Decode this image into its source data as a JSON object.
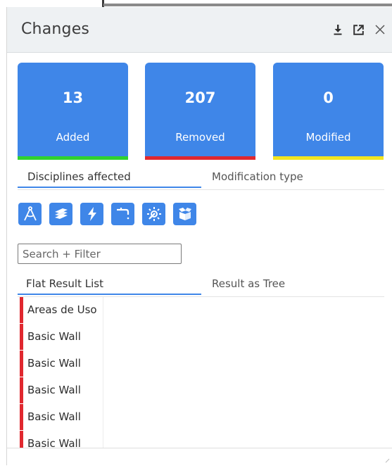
{
  "panel": {
    "title": "Changes"
  },
  "header_buttons": [
    "dock-icon",
    "popout-icon",
    "close-icon"
  ],
  "colors": {
    "accent": "#3f86e8",
    "added": "#2fd22f",
    "removed": "#e0282f",
    "modified": "#f3e61e"
  },
  "stats": [
    {
      "count": "13",
      "label": "Added"
    },
    {
      "count": "207",
      "label": "Removed"
    },
    {
      "count": "0",
      "label": "Modified"
    }
  ],
  "tabs_top": [
    {
      "label": "Disciplines affected",
      "active": true
    },
    {
      "label": "Modification type",
      "active": false
    }
  ],
  "discipline_icons": [
    "architecture-compass-icon",
    "structure-beam-icon",
    "electrical-bolt-icon",
    "plumbing-faucet-icon",
    "mechanical-gear-icon",
    "furniture-box-icon"
  ],
  "search": {
    "placeholder": "Search + Filter",
    "value": ""
  },
  "tabs_result": [
    {
      "label": "Flat Result List",
      "active": true
    },
    {
      "label": "Result as Tree",
      "active": false
    }
  ],
  "results": [
    "Areas de Uso",
    "Basic Wall",
    "Basic Wall",
    "Basic Wall",
    "Basic Wall",
    "Basic Wall"
  ]
}
